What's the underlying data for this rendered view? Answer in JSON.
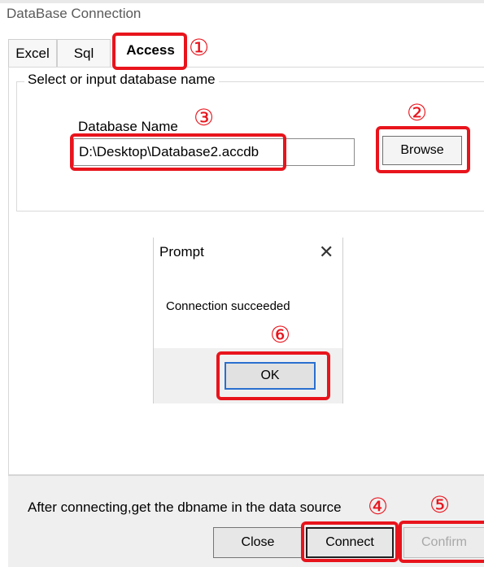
{
  "window": {
    "title": "DataBase Connection"
  },
  "tabs": [
    {
      "label": "Excel",
      "active": false
    },
    {
      "label": "Sql",
      "active": false
    },
    {
      "label": "Access",
      "active": true
    }
  ],
  "access": {
    "group_title": "Select or input database name",
    "db_label": "Database Name",
    "db_value": "D:\\Desktop\\Database2.accdb",
    "browse_label": "Browse"
  },
  "prompt": {
    "title": "Prompt",
    "close_glyph": "✕",
    "message": "Connection succeeded",
    "ok_label": "OK"
  },
  "footer": {
    "note": "After connecting,get the dbname in the data source",
    "close_label": "Close",
    "connect_label": "Connect",
    "confirm_label": "Confirm"
  },
  "annotations": {
    "color": "#e8141c",
    "steps": [
      "①",
      "②",
      "③",
      "④",
      "⑤",
      "⑥"
    ]
  }
}
